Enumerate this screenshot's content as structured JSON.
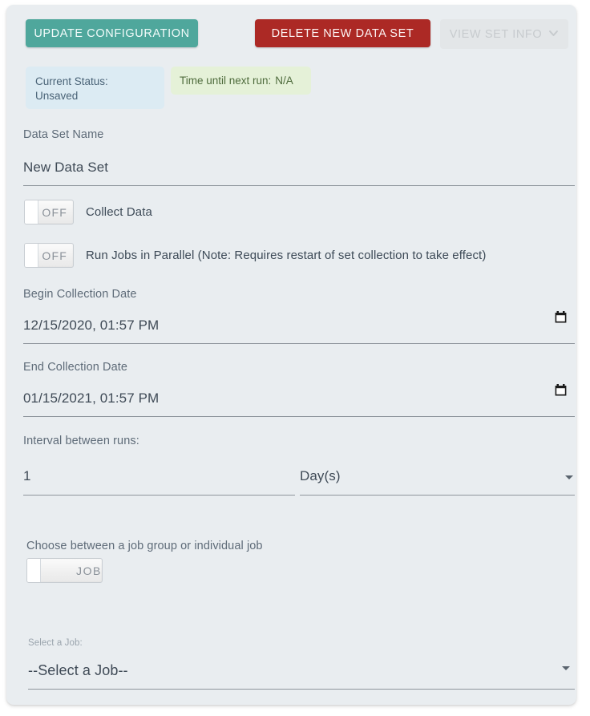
{
  "toolbar": {
    "update_label": "UPDATE CONFIGURATION",
    "delete_label": "DELETE NEW DATA SET",
    "view_info_label": "VIEW SET INFO",
    "view_info_icon": "chevron-down-icon"
  },
  "status": {
    "current_status_label": "Current Status:",
    "current_status_value": "Unsaved",
    "next_run_label": "Time until next run:",
    "next_run_value": "N/A"
  },
  "fields": {
    "data_set_name": {
      "label": "Data Set Name",
      "value": "New Data Set"
    },
    "begin_date": {
      "label": "Begin Collection Date",
      "value": "12/15/2020, 01:57 PM",
      "icon": "calendar-icon"
    },
    "end_date": {
      "label": "End Collection Date",
      "value": "01/15/2021, 01:57 PM",
      "icon": "calendar-icon"
    },
    "interval": {
      "label": "Interval between runs:",
      "amount": "1",
      "unit": "Day(s)"
    },
    "job_choice": {
      "label": "Choose between a job group or individual job",
      "toggle_text": "JOB"
    },
    "select_job": {
      "label": "Select a Job:",
      "value": "--Select a Job--"
    }
  },
  "toggles": {
    "collect_data": {
      "state_text": "OFF",
      "label": "Collect Data"
    },
    "run_parallel": {
      "state_text": "OFF",
      "label": "Run Jobs in Parallel (Note: Requires restart of set collection to take effect)"
    }
  },
  "colors": {
    "card_background": "#e9edf0",
    "primary_button": "#4fa79c",
    "danger_button": "#ac2925",
    "disabled_button": "#e3e6e8",
    "status_chip": "#dcebf3",
    "next_run_chip": "#e5f1d8"
  }
}
